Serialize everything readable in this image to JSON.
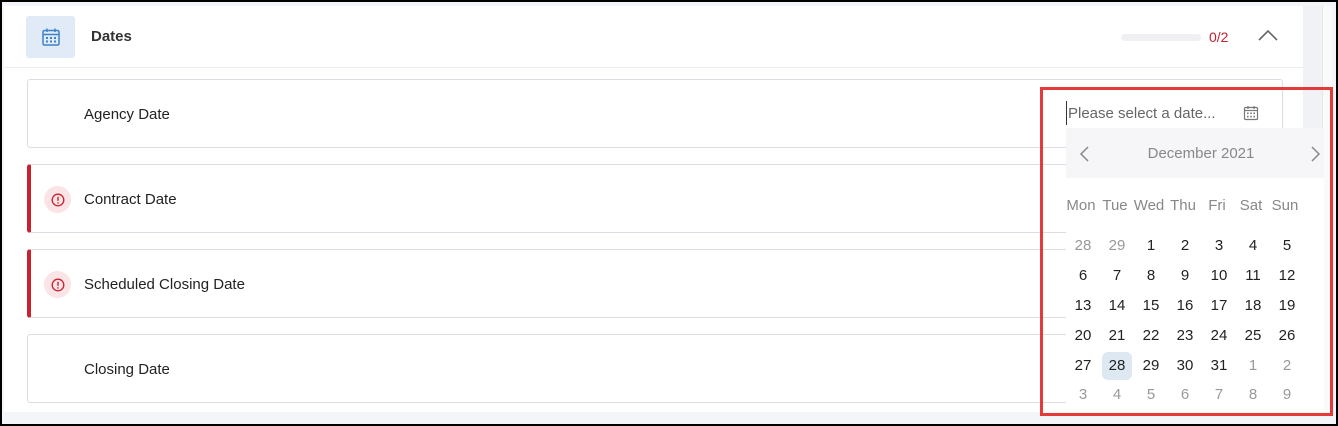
{
  "section": {
    "title": "Dates",
    "icon": "calendar-icon",
    "progress_text": "0/2",
    "progress_fraction": 0,
    "accent_color": "#c0232f",
    "icon_bg": "#e0ebf7"
  },
  "fields": [
    {
      "label": "Agency Date",
      "error": false
    },
    {
      "label": "Contract Date",
      "error": true
    },
    {
      "label": "Scheduled Closing Date",
      "error": true
    },
    {
      "label": "Closing Date",
      "error": false
    }
  ],
  "date_input": {
    "placeholder": "Please select a date...",
    "icon": "calendar-icon"
  },
  "datepicker": {
    "month_label": "December 2021",
    "prev_icon": "chevron-left-icon",
    "next_icon": "chevron-right-icon",
    "weekdays": [
      "Mon",
      "Tue",
      "Wed",
      "Thu",
      "Fri",
      "Sat",
      "Sun"
    ],
    "weeks": [
      [
        {
          "d": "28",
          "m": true
        },
        {
          "d": "29",
          "m": true
        },
        {
          "d": "1"
        },
        {
          "d": "2"
        },
        {
          "d": "3"
        },
        {
          "d": "4"
        },
        {
          "d": "5"
        }
      ],
      [
        {
          "d": "6"
        },
        {
          "d": "7"
        },
        {
          "d": "8"
        },
        {
          "d": "9"
        },
        {
          "d": "10"
        },
        {
          "d": "11"
        },
        {
          "d": "12"
        }
      ],
      [
        {
          "d": "13"
        },
        {
          "d": "14"
        },
        {
          "d": "15"
        },
        {
          "d": "16"
        },
        {
          "d": "17"
        },
        {
          "d": "18"
        },
        {
          "d": "19"
        }
      ],
      [
        {
          "d": "20"
        },
        {
          "d": "21"
        },
        {
          "d": "22"
        },
        {
          "d": "23"
        },
        {
          "d": "24"
        },
        {
          "d": "25"
        },
        {
          "d": "26"
        }
      ],
      [
        {
          "d": "27"
        },
        {
          "d": "28",
          "s": true
        },
        {
          "d": "29"
        },
        {
          "d": "30"
        },
        {
          "d": "31"
        },
        {
          "d": "1",
          "m": true
        },
        {
          "d": "2",
          "m": true
        }
      ],
      [
        {
          "d": "3",
          "m": true
        },
        {
          "d": "4",
          "m": true
        },
        {
          "d": "5",
          "m": true
        },
        {
          "d": "6",
          "m": true
        },
        {
          "d": "7",
          "m": true
        },
        {
          "d": "8",
          "m": true
        },
        {
          "d": "9",
          "m": true
        }
      ]
    ],
    "highlight_color": "#e53a3a"
  }
}
